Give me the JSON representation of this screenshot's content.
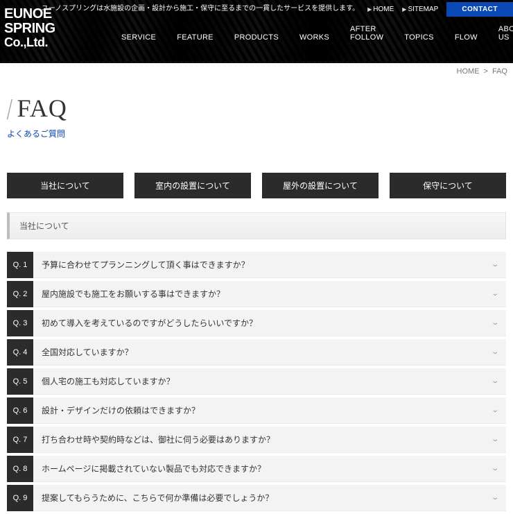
{
  "header": {
    "logo": {
      "line1": "EUNOE",
      "line2": "SPRING",
      "line3": "Co.,Ltd."
    },
    "tagline": "ユーノスプリングは水施設の企画・設計から施工・保守に至るまでの一貫したサービスを提供します。",
    "home_label": "HOME",
    "sitemap_label": "SITEMAP",
    "contact_label": "CONTACT",
    "nav": [
      {
        "label": "SERVICE"
      },
      {
        "label": "FEATURE"
      },
      {
        "label": "PRODUCTS"
      },
      {
        "label": "WORKS"
      },
      {
        "label": "AFTER FOLLOW"
      },
      {
        "label": "TOPICS"
      },
      {
        "label": "FLOW"
      },
      {
        "label": "ABOUT US"
      }
    ]
  },
  "breadcrumb": {
    "home": "HOME",
    "sep": ">",
    "current": "FAQ"
  },
  "page": {
    "title": "FAQ",
    "subtitle": "よくあるご質問"
  },
  "tabs": [
    {
      "label": "当社について"
    },
    {
      "label": "室内の設置について"
    },
    {
      "label": "屋外の設置について"
    },
    {
      "label": "保守について"
    }
  ],
  "section": {
    "title": "当社について"
  },
  "questions": [
    {
      "num": "Q. 1",
      "text": "予算に合わせてプランニングして頂く事はできますか？"
    },
    {
      "num": "Q. 2",
      "text": "屋内施設でも施工をお願いする事はできますか？"
    },
    {
      "num": "Q. 3",
      "text": "初めて導入を考えているのですがどうしたらいいですか？"
    },
    {
      "num": "Q. 4",
      "text": "全国対応していますか？"
    },
    {
      "num": "Q. 5",
      "text": "個人宅の施工も対応していますか？"
    },
    {
      "num": "Q. 6",
      "text": "設計・デザインだけの依頼はできますか？"
    },
    {
      "num": "Q. 7",
      "text": "打ち合わせ時や契約時などは、御社に伺う必要はありますか？"
    },
    {
      "num": "Q. 8",
      "text": "ホームページに掲載されていない製品でも対応できますか？"
    },
    {
      "num": "Q. 9",
      "text": "提案してもらうために、こちらで何か準備は必要でしょうか？"
    }
  ]
}
